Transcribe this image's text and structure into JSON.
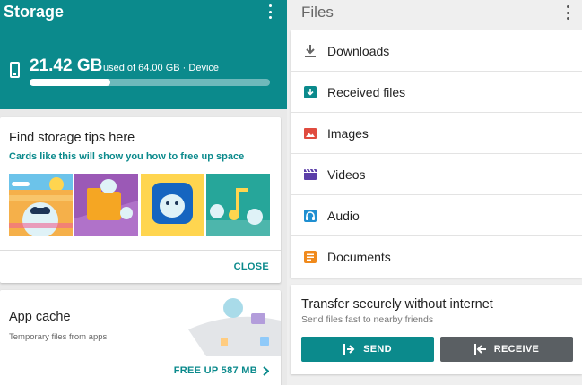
{
  "colors": {
    "accent": "#0b8a8c",
    "receive": "#5a5f63"
  },
  "storage": {
    "title": "Storage",
    "used": "21.42 GB",
    "of_text": "used of 64.00 GB · Device",
    "used_fraction": 0.335
  },
  "tips_card": {
    "title": "Find storage tips here",
    "subtitle": "Cards like this will show you how to free up space",
    "close_label": "CLOSE"
  },
  "cache_card": {
    "title": "App cache",
    "subtitle": "Temporary files from apps",
    "action_label": "FREE UP 587 MB"
  },
  "files": {
    "title": "Files",
    "items": [
      {
        "label": "Downloads",
        "icon": "download-icon",
        "color": "#666666"
      },
      {
        "label": "Received files",
        "icon": "received-files-icon",
        "color": "#0b8a8c"
      },
      {
        "label": "Images",
        "icon": "image-icon",
        "color": "#e04b3f"
      },
      {
        "label": "Videos",
        "icon": "video-icon",
        "color": "#5b3ea8"
      },
      {
        "label": "Audio",
        "icon": "headphones-icon",
        "color": "#1f8fd1"
      },
      {
        "label": "Documents",
        "icon": "document-icon",
        "color": "#f08a1c"
      }
    ]
  },
  "transfer": {
    "title": "Transfer securely without internet",
    "subtitle": "Send files fast to nearby friends",
    "send_label": "SEND",
    "receive_label": "RECEIVE"
  }
}
